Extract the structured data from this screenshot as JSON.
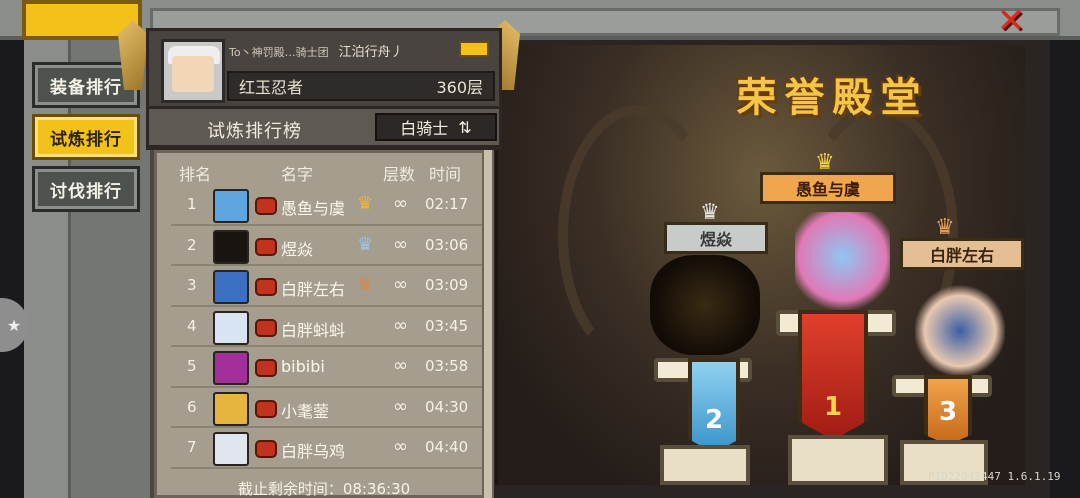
{
  "tabs": [
    {
      "label": "装备排行",
      "active": false
    },
    {
      "label": "试炼排行",
      "active": true
    },
    {
      "label": "讨伐排行",
      "active": false
    }
  ],
  "close_label": "✕",
  "player": {
    "guild_prefix": "To丶神罚殿…骑士团",
    "guild_name": "江泊行舟丿",
    "name": "红玉忍者",
    "floor": "360层"
  },
  "leaderboard": {
    "title": "试炼排行榜",
    "class_selector": "白骑士",
    "swap_icon": "⇅",
    "columns": {
      "rank": "排名",
      "name": "名字",
      "floors": "层数",
      "time": "时间"
    },
    "rows": [
      {
        "rank": "1",
        "name": "愚鱼与虞",
        "floors": "∞",
        "time": "02:17",
        "medal": "gold",
        "avatar_color": "#5fa6e0"
      },
      {
        "rank": "2",
        "name": "煜焱",
        "floors": "∞",
        "time": "03:06",
        "medal": "silver",
        "avatar_color": "#1a1410"
      },
      {
        "rank": "3",
        "name": "白胖左右",
        "floors": "∞",
        "time": "03:09",
        "medal": "bronze",
        "avatar_color": "#3a6fc2"
      },
      {
        "rank": "4",
        "name": "白胖蚪蚪",
        "floors": "∞",
        "time": "03:45",
        "medal": "",
        "avatar_color": "#d9e4f2"
      },
      {
        "rank": "5",
        "name": "bibibi",
        "floors": "∞",
        "time": "03:58",
        "medal": "",
        "avatar_color": "#a3309a"
      },
      {
        "rank": "6",
        "name": "小耄蓥",
        "floors": "∞",
        "time": "04:30",
        "medal": "",
        "avatar_color": "#e8b440"
      },
      {
        "rank": "7",
        "name": "白胖乌鸡",
        "floors": "∞",
        "time": "04:40",
        "medal": "",
        "avatar_color": "#dfe6ef"
      }
    ],
    "countdown": "截止剩余时间：08:36:30"
  },
  "hall": {
    "title": "荣誉殿堂",
    "first": {
      "name": "愚鱼与虞",
      "rank_label": "1"
    },
    "second": {
      "name": "煜焱",
      "rank_label": "2"
    },
    "third": {
      "name": "白胖左右",
      "rank_label": "3"
    }
  },
  "version": "PID22945447 1.6.1.19",
  "colors": {
    "accent": "#f2c21a",
    "title_gold": "#f5c548",
    "close_red": "#d62b1e"
  }
}
